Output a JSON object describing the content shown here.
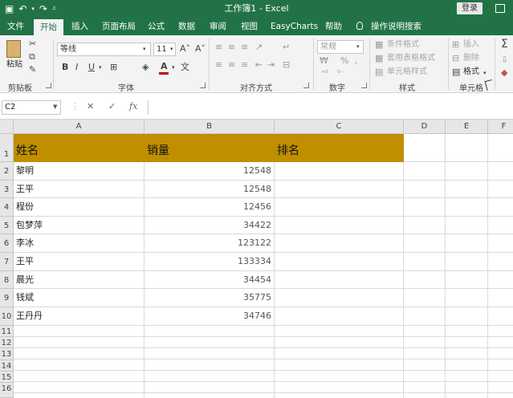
{
  "window": {
    "title": "工作簿1 - Excel",
    "login_label": "登录"
  },
  "qat": {
    "save_icon": "save-icon",
    "undo_icon": "undo-icon",
    "redo_icon": "redo-icon",
    "customize_icon": "customize-qat-icon"
  },
  "tabs": [
    {
      "label": "文件"
    },
    {
      "label": "开始"
    },
    {
      "label": "插入"
    },
    {
      "label": "页面布局"
    },
    {
      "label": "公式"
    },
    {
      "label": "数据"
    },
    {
      "label": "审阅"
    },
    {
      "label": "视图"
    },
    {
      "label": "EasyCharts"
    },
    {
      "label": "帮助"
    },
    {
      "label": "操作说明搜索"
    }
  ],
  "ribbon": {
    "clipboard": {
      "paste_label": "粘贴",
      "group_label": "剪贴板"
    },
    "font": {
      "font_name": "等线",
      "font_size": "11",
      "group_label": "字体",
      "bold": "B",
      "italic": "I",
      "underline": "U",
      "grow": "A˄",
      "shrink": "A˅",
      "font_color_letter": "A",
      "font_color": "#c00000"
    },
    "alignment": {
      "group_label": "对齐方式"
    },
    "number": {
      "format": "常规",
      "percent": "%",
      "comma": ",",
      "group_label": "数字"
    },
    "styles": {
      "conditional": "条件格式",
      "table": "套用表格格式",
      "cell_styles": "单元格样式",
      "group_label": "样式"
    },
    "cells": {
      "insert": "插入",
      "delete": "删除",
      "format": "格式",
      "group_label": "单元格"
    }
  },
  "formula_bar": {
    "name_box": "C2",
    "cancel": "✕",
    "enter": "✓",
    "fx": "fx",
    "formula": ""
  },
  "sheet": {
    "columns": [
      "A",
      "B",
      "C",
      "D",
      "E",
      "F"
    ],
    "rows": [
      "1",
      "2",
      "3",
      "4",
      "5",
      "6",
      "7",
      "8",
      "9",
      "10",
      "11",
      "12",
      "13",
      "14",
      "15",
      "16"
    ],
    "header": {
      "a": "姓名",
      "b": "销量",
      "c": "排名",
      "fill": "#bf8f00"
    },
    "records": [
      {
        "name": "黎明",
        "sales": "12548"
      },
      {
        "name": "王平",
        "sales": "12548"
      },
      {
        "name": "程份",
        "sales": "12456"
      },
      {
        "name": "包梦萍",
        "sales": "34422"
      },
      {
        "name": "李冰",
        "sales": "123122"
      },
      {
        "name": "王平",
        "sales": "133334"
      },
      {
        "name": "晨光",
        "sales": "34454"
      },
      {
        "name": "钱斌",
        "sales": "35775"
      },
      {
        "name": "王丹丹",
        "sales": "34746"
      }
    ]
  },
  "colors": {
    "excel_green": "#217346"
  }
}
